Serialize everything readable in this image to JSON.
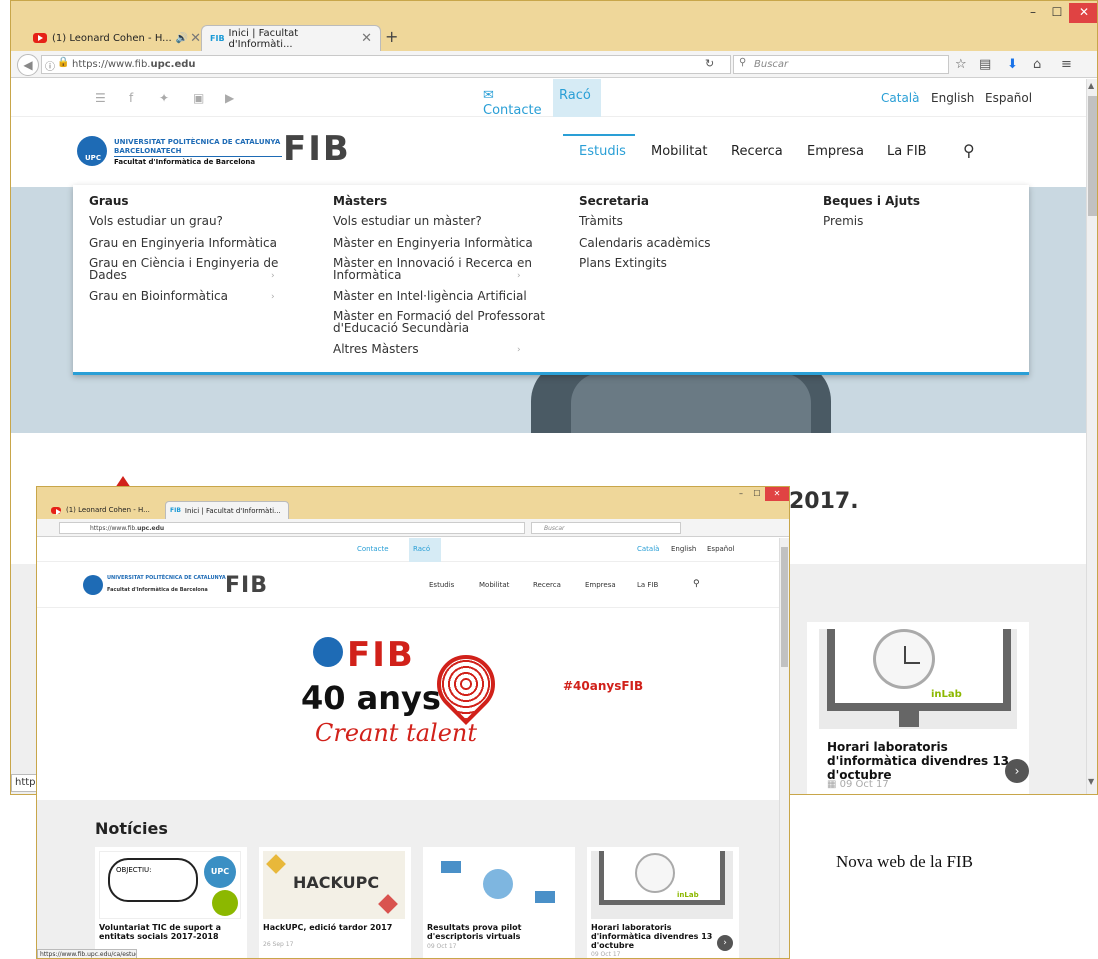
{
  "browser": {
    "tabs": [
      {
        "label": "(1) Leonard Cohen - H...",
        "audio": "🔊"
      },
      {
        "label": "Inici | Facultat d'Informàti...",
        "favicon": "FIB"
      }
    ],
    "url_prefix": "https://www.fib.",
    "url_domain": "upc.edu",
    "search_placeholder": "Buscar",
    "status_url_short": "http"
  },
  "site": {
    "contacte": "Contacte",
    "raco": "Racó",
    "langs": [
      "Català",
      "English",
      "Español"
    ],
    "upc_line1": "UNIVERSITAT POLITÈCNICA DE CATALUNYA",
    "upc_line2": "BARCELONATECH",
    "upc_line3": "Facultat d'Informàtica de Barcelona",
    "upc_badge": "UPC",
    "fib": "FIB",
    "nav": [
      "Estudis",
      "Mobilitat",
      "Recerca",
      "Empresa",
      "La FIB"
    ]
  },
  "dropdown": {
    "graus": {
      "heading": "Graus",
      "items": [
        "Vols estudiar un grau?",
        "Grau en Enginyeria Informàtica",
        "Grau en Ciència i Enginyeria de",
        "Dades",
        "Grau en Bioinformàtica"
      ]
    },
    "masters": {
      "heading": "Màsters",
      "items": [
        "Vols estudiar un màster?",
        "Màster en Enginyeria Informàtica",
        "Màster en Innovació i Recerca en",
        "Informàtica",
        "Màster en Intel·ligència Artificial",
        "Màster en Formació del Professorat",
        "d'Educació Secundària",
        "Altres Màsters"
      ]
    },
    "secretaria": {
      "heading": "Secretaria",
      "items": [
        "Tràmits",
        "Calendaris acadèmics",
        "Plans Extingits"
      ]
    },
    "beques": {
      "heading": "Beques i Ajuts",
      "items": [
        "Premis"
      ]
    }
  },
  "page": {
    "year_fragment": "2017.",
    "right_card": {
      "title": "Horari laboratoris d'informàtica divendres 13 d'octubre",
      "date": "09 Oct 17",
      "inlab": "inLab"
    }
  },
  "inner": {
    "url_prefix": "https://www.fib.",
    "url_domain": "upc.edu",
    "search_placeholder": "Buscar",
    "hero": {
      "fib": "FIB",
      "anys": "40 anys",
      "creant": "Creant talent",
      "hashtag": "#40anysFIB"
    },
    "noticies": "Notícies",
    "news": [
      {
        "title": "Voluntariat TIC de suport a entitats socials 2017-2018",
        "date": ""
      },
      {
        "title": "HackUPC, edició tardor 2017",
        "date": "26 Sep 17"
      },
      {
        "title": "Resultats prova pilot d'escriptoris virtuals",
        "date": "09 Oct 17"
      },
      {
        "title": "Horari laboratoris d'informàtica divendres 13 d'octubre",
        "date": "09 Oct 17"
      }
    ],
    "news_img_text": {
      "objectiu": "OBJECTIU:",
      "upc": "UPC",
      "hack": "HACKUPC",
      "inlab": "inLab"
    },
    "status_url": "https://www.fib.upc.edu/ca/estudis"
  },
  "caption": "Nova web de la FIB"
}
